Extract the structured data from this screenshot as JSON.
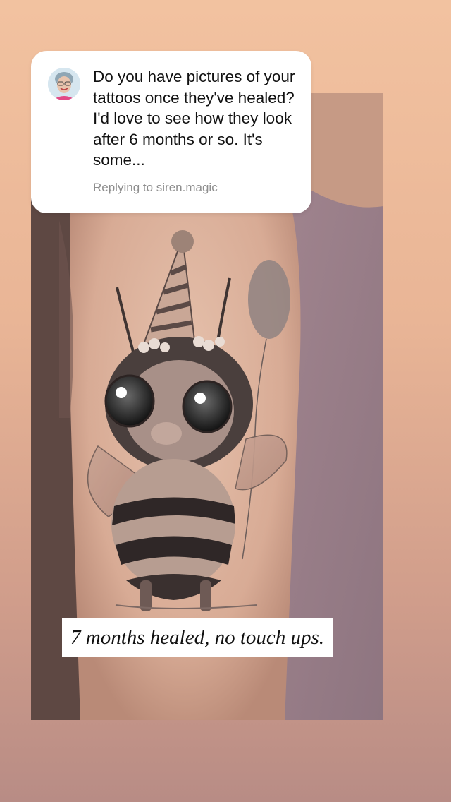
{
  "story": {
    "question_sticker": {
      "avatar_icon": "user-avatar",
      "question_text": "Do you have pictures of your tattoos once they've healed? I'd love to see how they look after 6 months or so.  It's some...",
      "replying_to": "Replying to siren.magic"
    },
    "caption": "7 months healed, no touch ups.",
    "photo_icon": "bee-tattoo-photo"
  },
  "colors": {
    "background_top": "#f2c2a0",
    "background_bottom": "#b88c85",
    "card": "#ffffff",
    "text": "#111111",
    "secondary_text": "#8e8e8e"
  }
}
